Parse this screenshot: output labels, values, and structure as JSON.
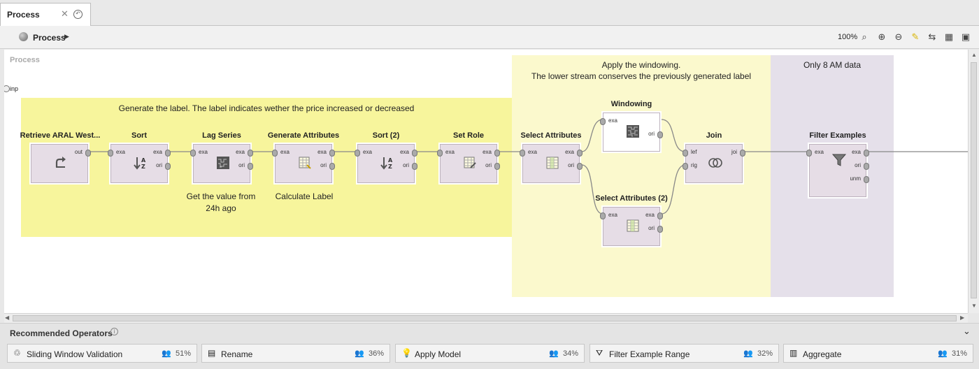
{
  "tab": {
    "title": "Process"
  },
  "toolbar": {
    "breadcrumb": "Process",
    "zoom": "100%"
  },
  "canvas": {
    "label": "Process",
    "input_port": "inp"
  },
  "areas": [
    {
      "text": "Generate the label. The label indicates wether the price increased or decreased"
    },
    {
      "text": "Apply the windowing.\nThe lower stream conserves the previously generated label"
    },
    {
      "text": "Only 8 AM data"
    }
  ],
  "operators": [
    {
      "title": "Retrieve ARAL West...",
      "ports_in": [],
      "ports_out": [
        "out"
      ]
    },
    {
      "title": "Sort",
      "ports_in": [
        "exa"
      ],
      "ports_out": [
        "exa",
        "ori"
      ]
    },
    {
      "title": "Lag Series",
      "ports_in": [
        "exa"
      ],
      "ports_out": [
        "exa",
        "ori"
      ]
    },
    {
      "title": "Generate Attributes",
      "ports_in": [
        "exa"
      ],
      "ports_out": [
        "exa",
        "ori"
      ]
    },
    {
      "title": "Sort (2)",
      "ports_in": [
        "exa"
      ],
      "ports_out": [
        "exa",
        "ori"
      ]
    },
    {
      "title": "Set Role",
      "ports_in": [
        "exa"
      ],
      "ports_out": [
        "exa",
        "ori"
      ]
    },
    {
      "title": "Select Attributes",
      "ports_in": [
        "exa"
      ],
      "ports_out": [
        "exa",
        "ori"
      ]
    },
    {
      "title": "Windowing",
      "ports_in": [
        "exa"
      ],
      "ports_out": [
        "ori"
      ]
    },
    {
      "title": "Select Attributes (2)",
      "ports_in": [
        "exa"
      ],
      "ports_out": [
        "exa",
        "ori"
      ]
    },
    {
      "title": "Join",
      "ports_in": [
        "lef",
        "rig"
      ],
      "ports_out": [
        "joi"
      ]
    },
    {
      "title": "Filter Examples",
      "ports_in": [
        "exa"
      ],
      "ports_out": [
        "exa",
        "ori",
        "unm"
      ]
    }
  ],
  "captions": {
    "lag": "Get the value from\n24h ago",
    "gen": "Calculate Label"
  },
  "recommended": {
    "title": "Recommended Operators",
    "items": [
      {
        "label": "Sliding Window Validation",
        "pct": "51%",
        "icon": "validation-icon"
      },
      {
        "label": "Rename",
        "pct": "36%",
        "icon": "rename-icon"
      },
      {
        "label": "Apply Model",
        "pct": "34%",
        "icon": "lightbulb-icon"
      },
      {
        "label": "Filter Example Range",
        "pct": "32%",
        "icon": "funnel-icon"
      },
      {
        "label": "Aggregate",
        "pct": "31%",
        "icon": "aggregate-icon"
      }
    ]
  },
  "colors": {
    "yellow_area": "#f7f59c",
    "light_yellow_area": "#fbf9cd",
    "purple_area": "#e5e0ea",
    "operator": "#e6dde6"
  }
}
